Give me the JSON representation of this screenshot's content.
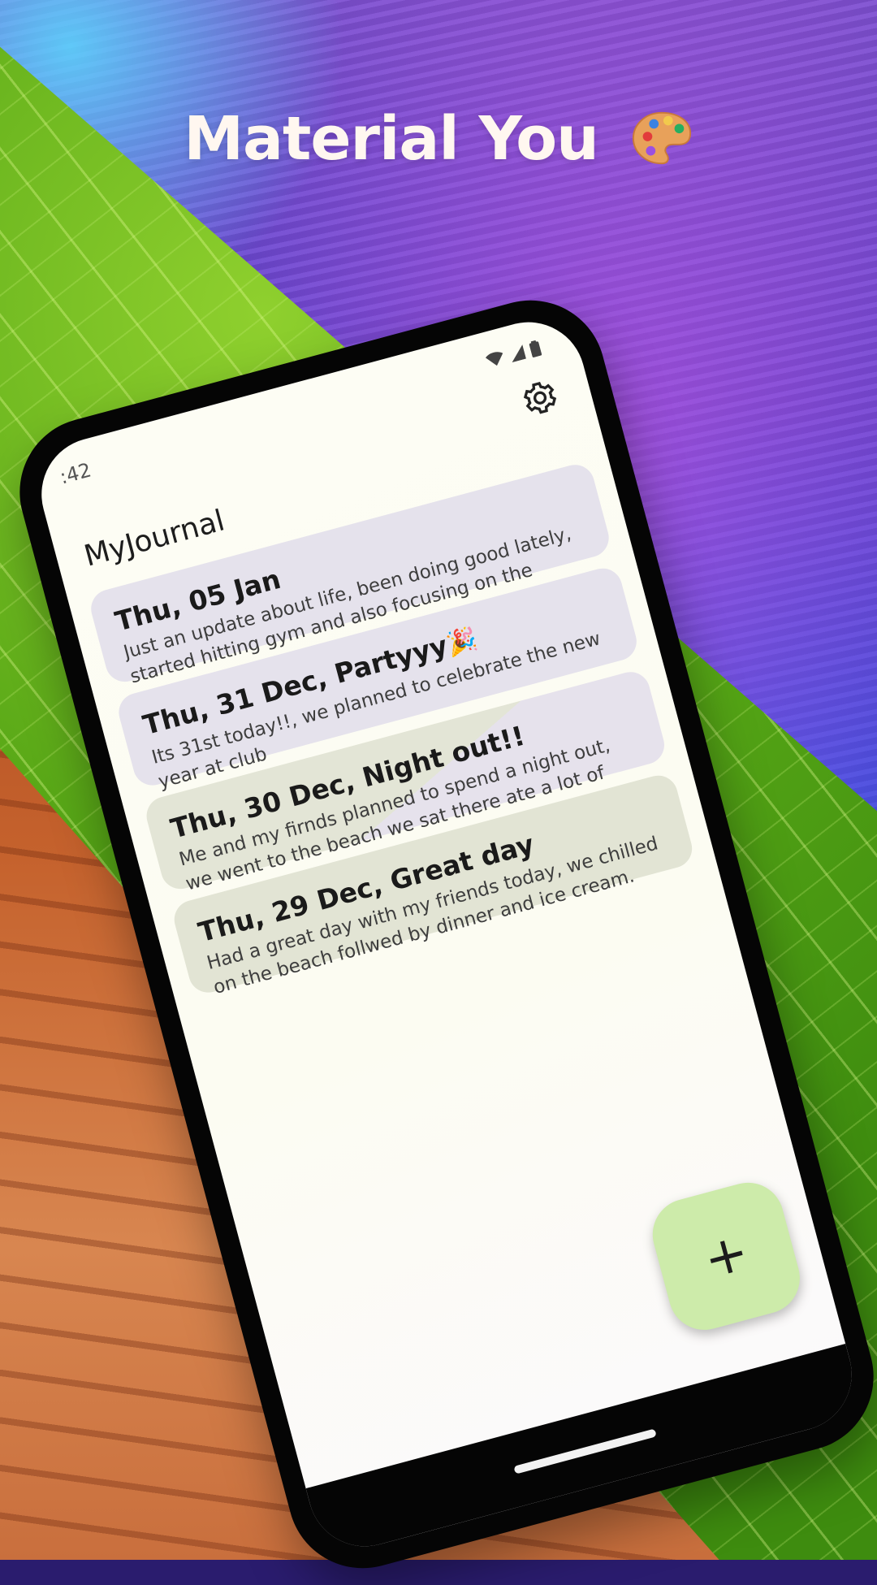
{
  "headline": "Material You",
  "headline_icon": "palette-emoji",
  "status_bar": {
    "time": ":42",
    "icons": [
      "wifi-icon",
      "signal-icon",
      "battery-icon"
    ]
  },
  "app": {
    "title": "MyJournal",
    "settings_icon": "gear-icon"
  },
  "entries": [
    {
      "title": "Thu, 05 Jan",
      "body": "Just an update about life, been doing good lately, started hitting gym and also focusing on the"
    },
    {
      "title": "Thu, 31 Dec, Partyyy",
      "title_icon": "party-popper",
      "body": "Its 31st today!!, we planned to celebrate the new year at club"
    },
    {
      "title": "Thu, 30 Dec, Night out!!",
      "body": "Me and my firnds planned to spend a night out, we went to the beach we sat there ate a lot of food and"
    },
    {
      "title": "Thu, 29 Dec, Great day",
      "body": "Had a great day with my friends today, we chilled on the beach follwed by dinner and ice cream."
    }
  ],
  "fab": {
    "label": "+",
    "icon": "add-icon"
  },
  "colors": {
    "card_purple": "#e5e2ec",
    "card_green": "#e2e4d4",
    "fab": "#cdebaa",
    "screen": "#fdfdf4"
  }
}
